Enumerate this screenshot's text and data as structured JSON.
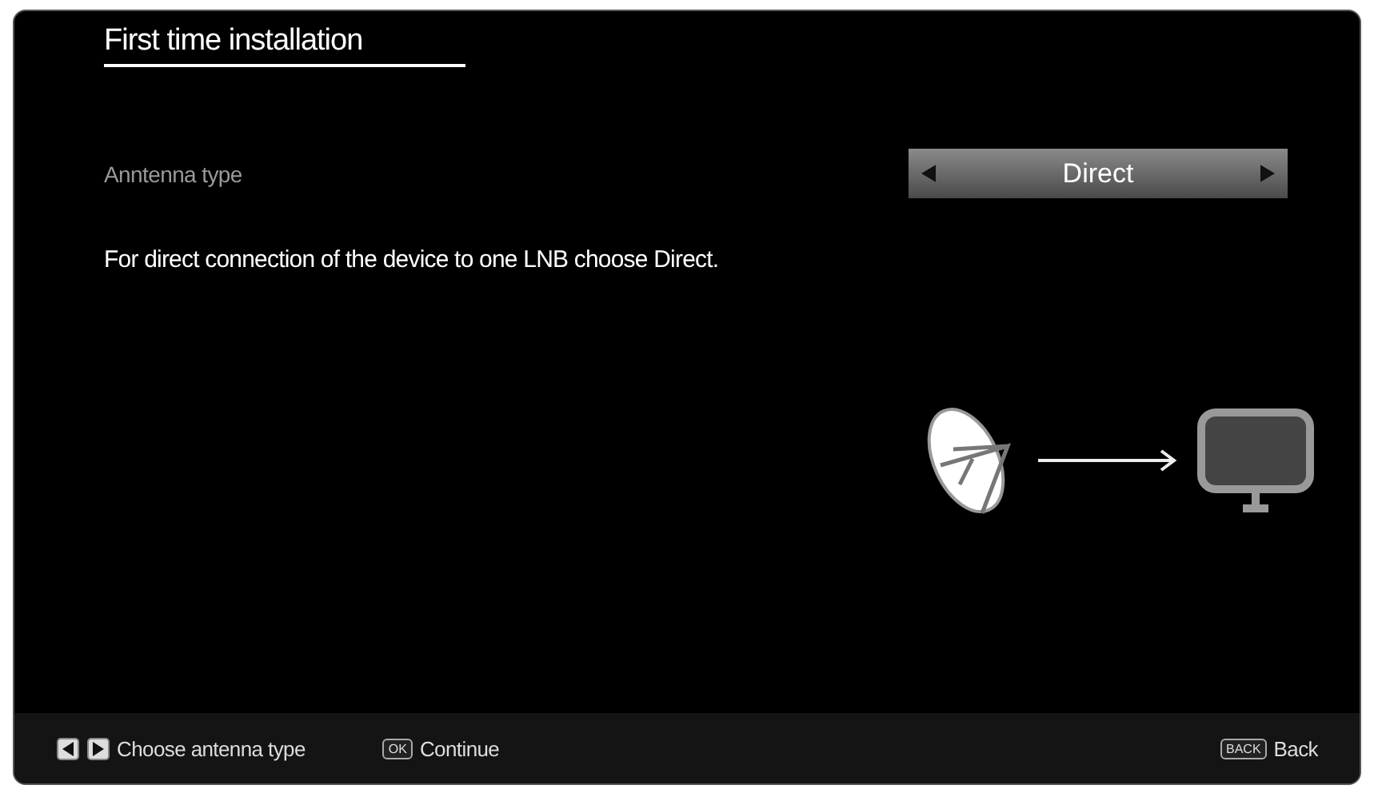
{
  "title": "First time installation",
  "setting": {
    "label": "Anntenna type",
    "value": "Direct"
  },
  "description": "For direct connection of the device to one LNB choose Direct.",
  "hints": [
    {
      "kind": "arrows",
      "text": "Choose antenna type"
    },
    {
      "kind": "key",
      "key": "OK",
      "text": "Continue"
    },
    {
      "kind": "key",
      "key": "BACK",
      "text": "Back"
    }
  ]
}
